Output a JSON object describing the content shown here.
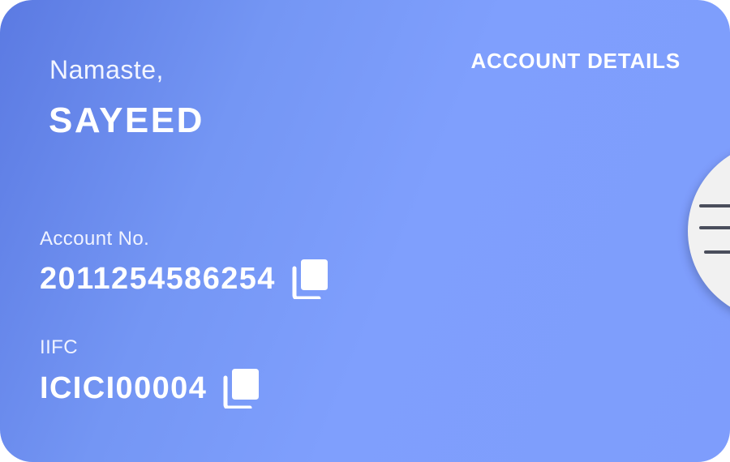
{
  "greeting": "Namaste,",
  "user_name": "SAYEED",
  "account_details_link": "ACCOUNT DETAILS",
  "account": {
    "label": "Account No.",
    "value": "2011254586254"
  },
  "iifc": {
    "label": "IIFC",
    "value": "ICICI00004"
  },
  "icons": {
    "copy": "copy-icon",
    "menu": "hamburger-menu-icon"
  },
  "colors": {
    "card_gradient_start": "#5b7ae2",
    "card_gradient_end": "#7f9ffd",
    "text": "#ffffff",
    "menu_button_bg": "#f1f1f1",
    "menu_icon": "#4a4e5c"
  }
}
